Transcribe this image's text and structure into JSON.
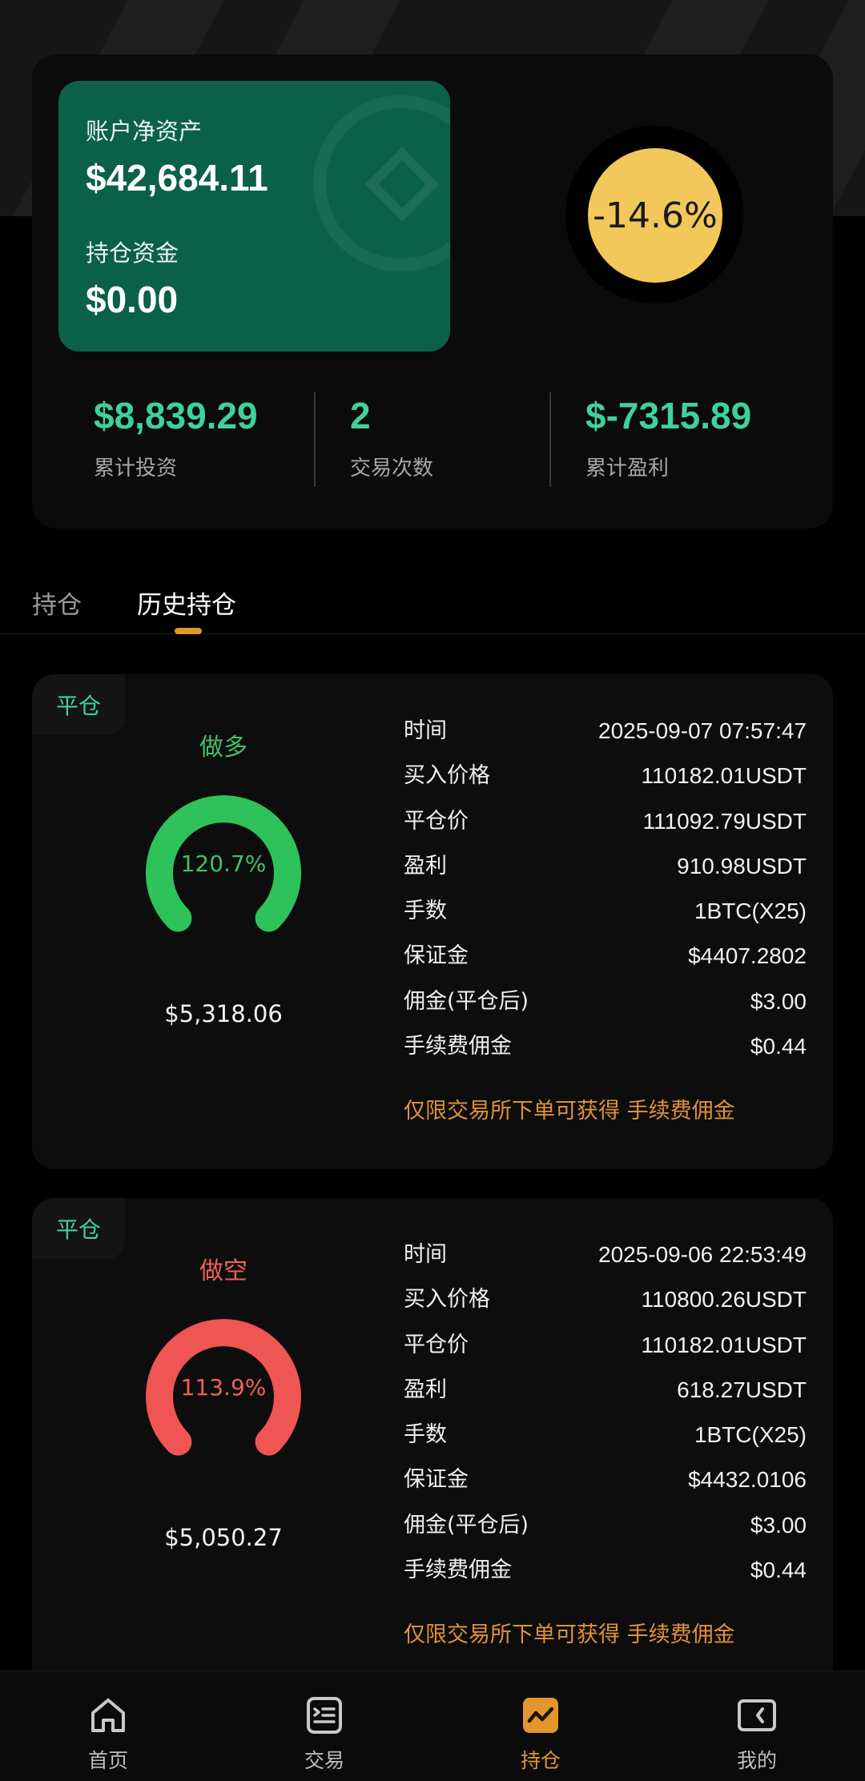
{
  "summary": {
    "net_asset_label": "账户净资产",
    "net_asset_value": "$42,684.11",
    "position_funds_label": "持仓资金",
    "position_funds_value": "$0.00",
    "ratio": "-14.6%",
    "stats": [
      {
        "value": "$8,839.29",
        "label": "累计投资",
        "color": "#3fd19b"
      },
      {
        "value": "2",
        "label": "交易次数",
        "color": "#3fd19b"
      },
      {
        "value": "$-7315.89",
        "label": "累计盈利",
        "color": "#3fd19b"
      }
    ]
  },
  "tabs": [
    {
      "label": "持仓",
      "active": false
    },
    {
      "label": "历史持仓",
      "active": true
    }
  ],
  "records": [
    {
      "badge": "平仓",
      "direction": "做多",
      "direction_color": "#3fc06a",
      "gauge_percent": "120.7%",
      "gauge_color": "#2ec25a",
      "amount": "$5,318.06",
      "rows": [
        {
          "k": "时间",
          "v": "2025-09-07 07:57:47"
        },
        {
          "k": "买入价格",
          "v": "110182.01USDT"
        },
        {
          "k": "平仓价",
          "v": "111092.79USDT"
        },
        {
          "k": "盈利",
          "v": "910.98USDT"
        },
        {
          "k": "手数",
          "v": "1BTC(X25)"
        },
        {
          "k": "保证金",
          "v": "$4407.2802"
        },
        {
          "k": "佣金(平仓后)",
          "v": "$3.00"
        },
        {
          "k": "手续费佣金",
          "v": "$0.44"
        }
      ],
      "note": "仅限交易所下单可获得 手续费佣金"
    },
    {
      "badge": "平仓",
      "direction": "做空",
      "direction_color": "#f0605c",
      "gauge_percent": "113.9%",
      "gauge_color": "#ee5553",
      "amount": "$5,050.27",
      "rows": [
        {
          "k": "时间",
          "v": "2025-09-06 22:53:49"
        },
        {
          "k": "买入价格",
          "v": "110800.26USDT"
        },
        {
          "k": "平仓价",
          "v": "110182.01USDT"
        },
        {
          "k": "盈利",
          "v": "618.27USDT"
        },
        {
          "k": "手数",
          "v": "1BTC(X25)"
        },
        {
          "k": "保证金",
          "v": "$4432.0106"
        },
        {
          "k": "佣金(平仓后)",
          "v": "$3.00"
        },
        {
          "k": "手续费佣金",
          "v": "$0.44"
        }
      ],
      "note": "仅限交易所下单可获得 手续费佣金"
    }
  ],
  "nav": [
    {
      "label": "首页",
      "icon": "home-icon",
      "active": false
    },
    {
      "label": "交易",
      "icon": "list-icon",
      "active": false
    },
    {
      "label": "持仓",
      "icon": "chart-icon",
      "active": true
    },
    {
      "label": "我的",
      "icon": "wallet-icon",
      "active": false
    }
  ],
  "colors": {
    "accent": "#e2962c",
    "profit": "#3fd19b",
    "card_green": "#0b6148",
    "ratio_yellow": "#f2c85a"
  }
}
